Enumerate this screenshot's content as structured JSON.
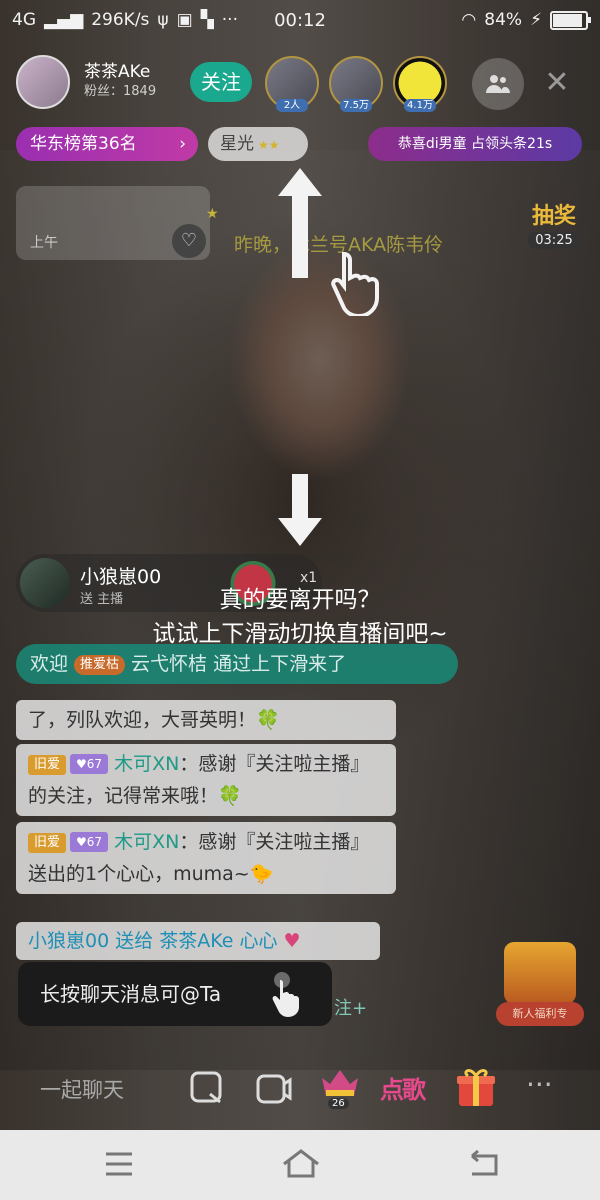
{
  "status_bar": {
    "network": "4G",
    "speed": "296K/s",
    "more": "···",
    "time": "00:12",
    "battery": "84%",
    "battery_level": 0.84
  },
  "anchor": {
    "name": "茶茶AKe",
    "fans": "粉丝：1849",
    "follow_label": "关注"
  },
  "viewers": [
    {
      "tag": "2人"
    },
    {
      "tag": "7.5万"
    },
    {
      "tag": "4.1万"
    }
  ],
  "rank": {
    "label": "华东榜第36名",
    "chevron": "›",
    "star_label": "星光",
    "headline": "恭喜di男童 占领头条21s"
  },
  "top_card": {
    "label": "上午"
  },
  "banner": {
    "text": "昨晚，木兰号AKA陈韦伶"
  },
  "hot_badge": {
    "word": "抽奖",
    "timer": "03:25"
  },
  "hint": {
    "line1": "真的要离开吗？",
    "line2": "试试上下滑动切换直播间吧~"
  },
  "gift_card": {
    "name": "小狼崽00",
    "sub": "送 主播",
    "x": "x1"
  },
  "chat": {
    "welcome_prefix": "欢迎",
    "welcome_badge": "推爱枯",
    "welcome_text": "云弋怀桔 通过上下滑来了",
    "msg0": "了，列队欢迎，大哥英明！🍀",
    "msg1": {
      "old_tag": "旧爱",
      "level": "♥67",
      "text_teal": "木可XN",
      "text": "：感谢『关注啦主播』的关注，记得常来哦！🍀"
    },
    "msg2": {
      "old_tag": "旧爱",
      "level": "♥67",
      "text_teal": "木可XN",
      "text": "：感谢『关注啦主播』送出的1个心心，muma~🐤"
    },
    "gift_line": "小狼崽00 送给 茶茶AKe 心心",
    "gift_heart": "♥"
  },
  "tooltip": {
    "text": "长按聊天消息可@Ta"
  },
  "follow_plus": "注+",
  "gift_box": {
    "label": "新人福利专"
  },
  "bottom_bar": {
    "chat_placeholder": "一起聊天",
    "gift_level": "26",
    "song": "点歌",
    "more": "···"
  },
  "colors": {
    "follow": "#1aa88f",
    "rank": "#9a2fb0",
    "welcome": "#14968a",
    "accent_pink": "#e64a8c"
  }
}
